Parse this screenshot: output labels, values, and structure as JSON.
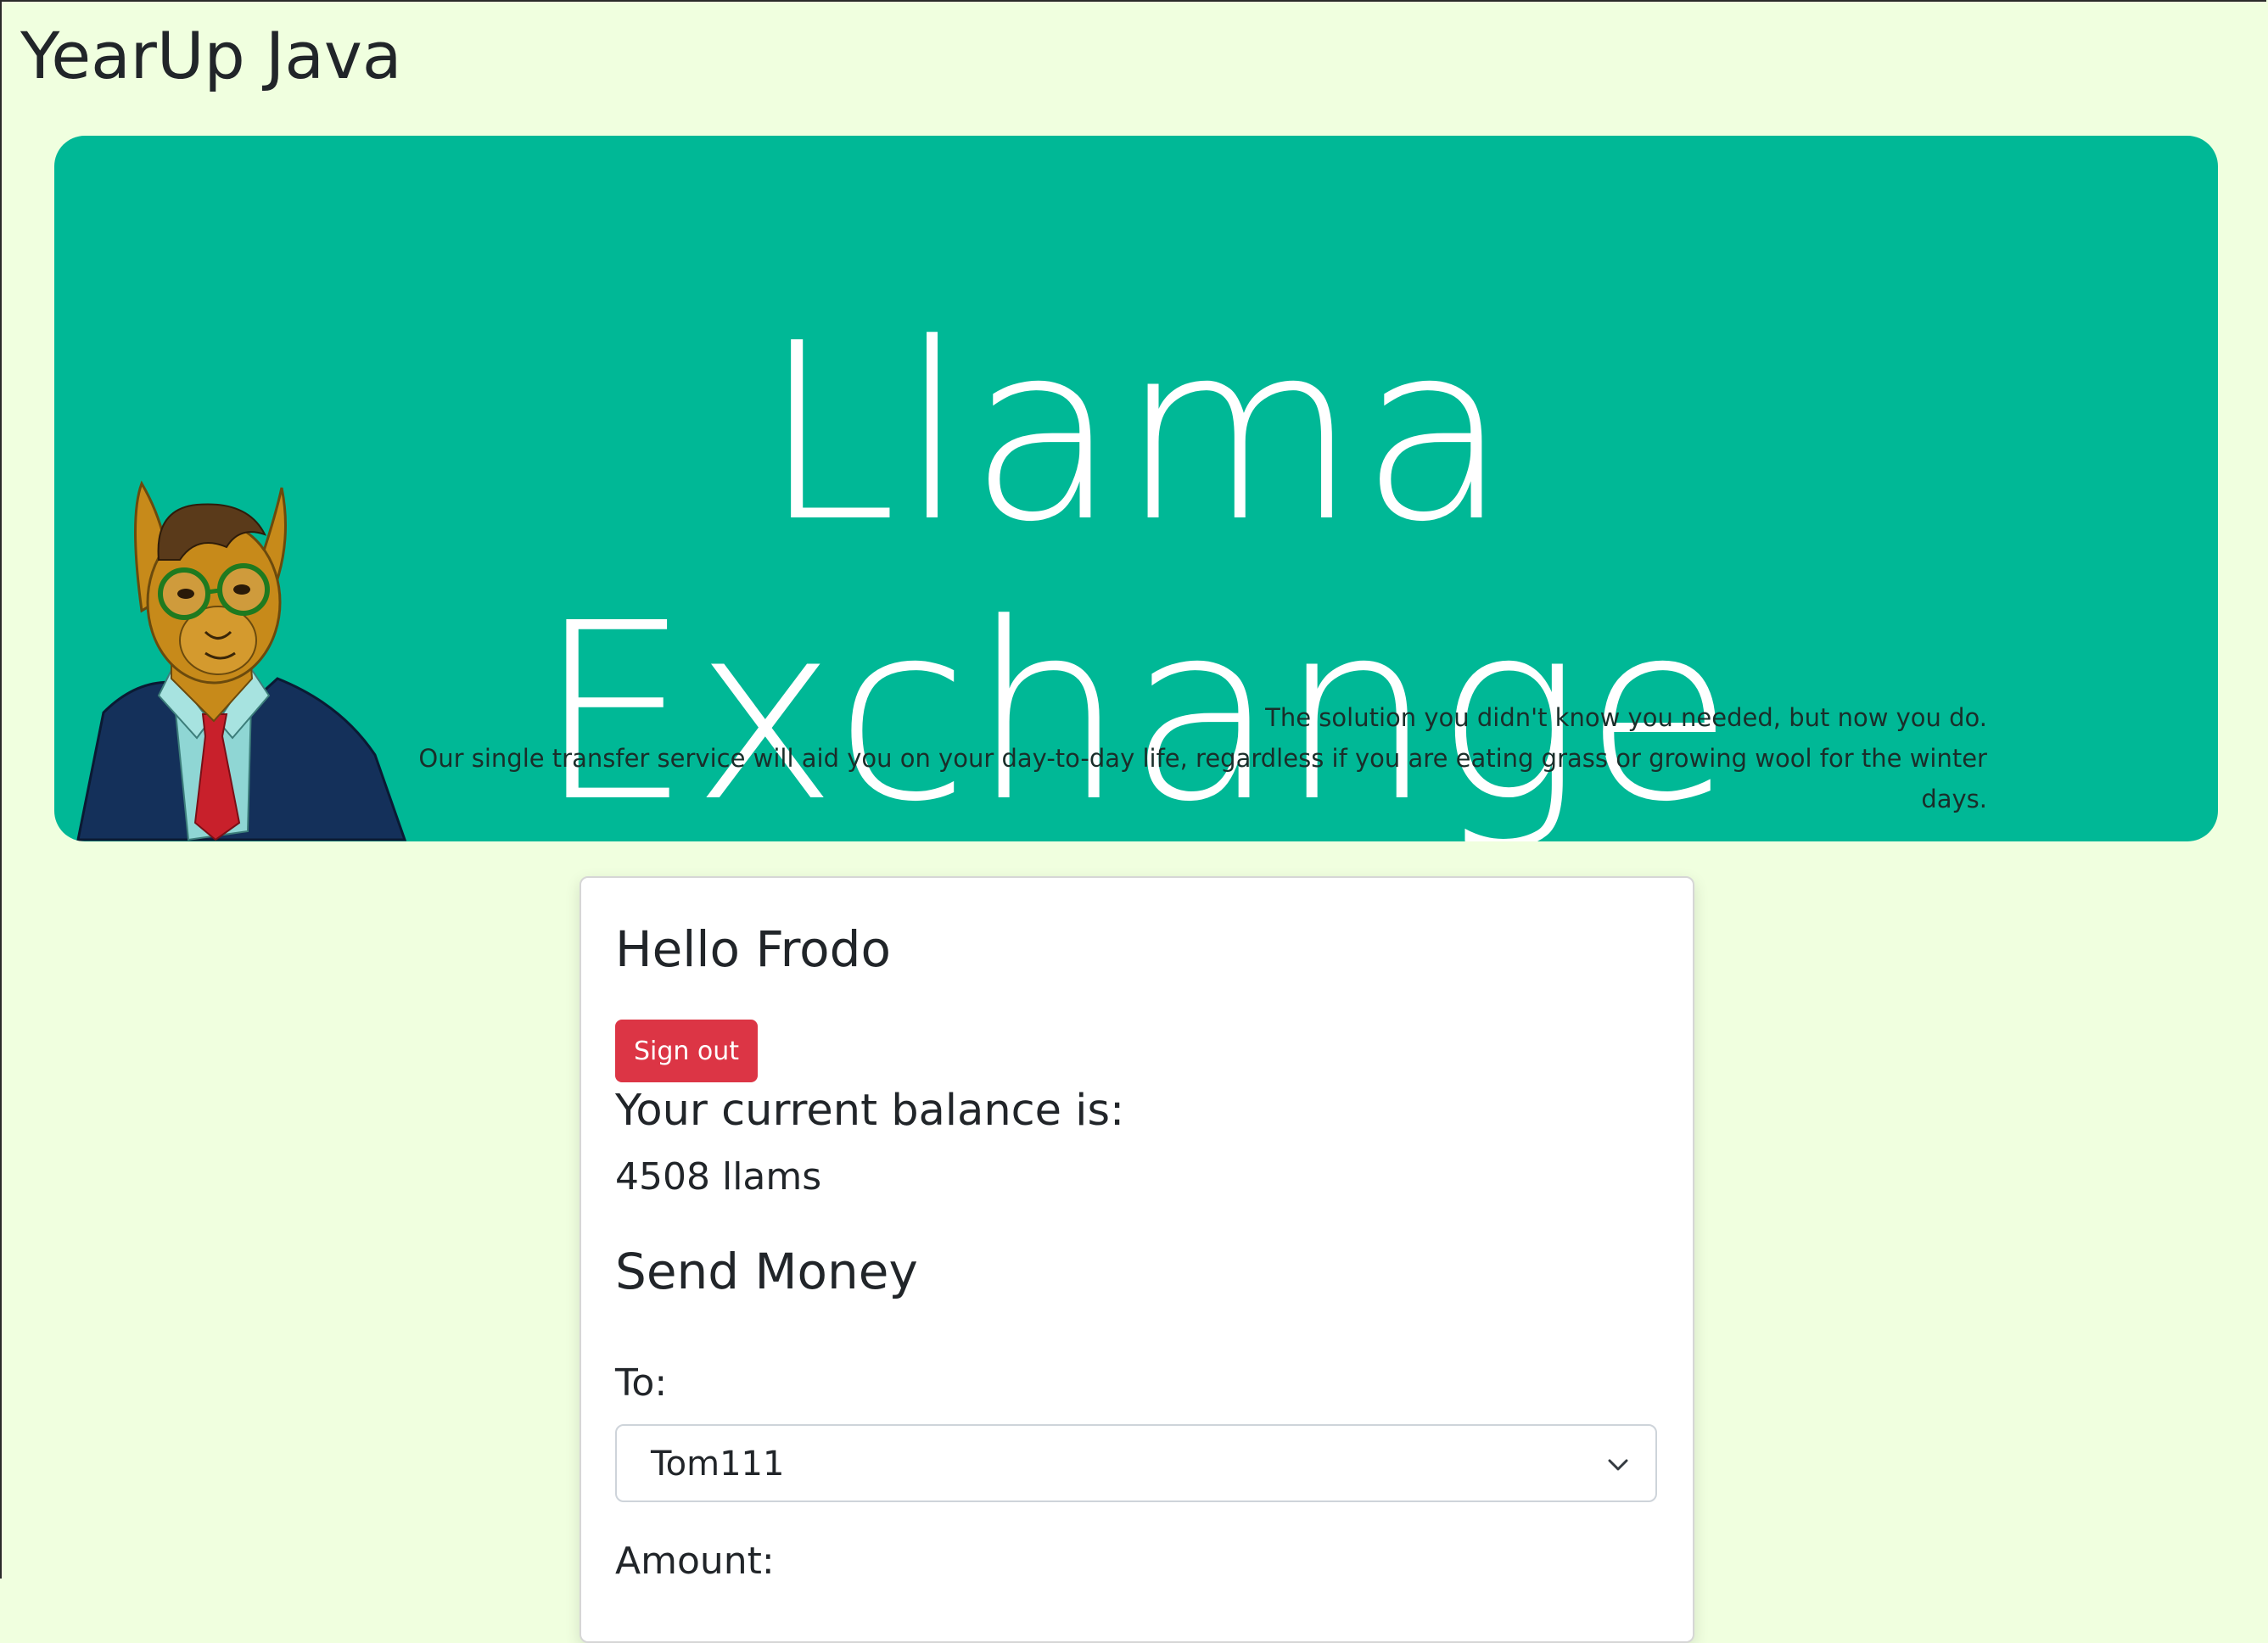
{
  "site": {
    "title": "YearUp Java"
  },
  "hero": {
    "title_line1": "Llama",
    "title_line2": "Exchange",
    "tagline_line1": "The solution you didn't know you needed, but now you do.",
    "tagline_line2": "Our single transfer service will aid you on your day-to-day life, regardless if you are eating grass or growing wool for the winter days.",
    "background_color": "#00b896"
  },
  "account": {
    "greeting": "Hello Frodo",
    "signout_label": "Sign out",
    "balance_label": "Your current balance is:",
    "balance_value": "4508 llams"
  },
  "send": {
    "heading": "Send Money",
    "to_label": "To:",
    "to_selected": "Tom111",
    "amount_label": "Amount:"
  },
  "colors": {
    "page_background": "#f0ffdf",
    "signout_button": "#dc3545"
  }
}
